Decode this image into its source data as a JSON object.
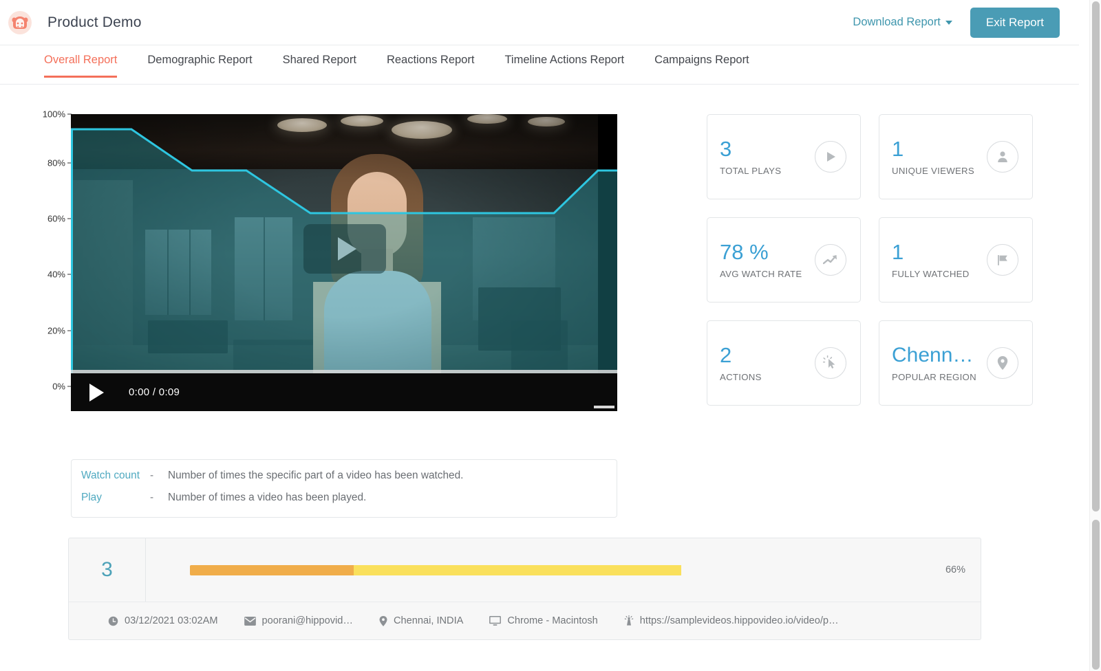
{
  "header": {
    "logo_icon": "hippo-logo-icon",
    "title": "Product Demo",
    "download_label": "Download Report",
    "exit_label": "Exit Report",
    "accent_color": "#f4705a",
    "button_color": "#4a9cb5",
    "link_color": "#3f96ad"
  },
  "tabs": [
    {
      "label": "Overall Report",
      "active": true
    },
    {
      "label": "Demographic Report",
      "active": false
    },
    {
      "label": "Shared Report",
      "active": false
    },
    {
      "label": "Reactions Report",
      "active": false
    },
    {
      "label": "Timeline Actions Report",
      "active": false
    },
    {
      "label": "Campaigns Report",
      "active": false
    }
  ],
  "player": {
    "current_time": "0:00",
    "duration": "0:09",
    "time_display": "0:00 / 0:09",
    "play_icon": "play-icon",
    "overlay_play_icon": "play-overlay-icon"
  },
  "chart_data": {
    "type": "area",
    "title": "Watch count over video timeline",
    "xlabel": "",
    "ylabel": "",
    "ylim": [
      0,
      100
    ],
    "yticks": [
      "0%",
      "20%",
      "40%",
      "60%",
      "80%",
      "100%"
    ],
    "ytick_values": [
      0,
      20,
      40,
      60,
      80,
      100
    ],
    "grid": false,
    "line_color": "#2ec6e0",
    "fill_color": "rgba(45,160,170,0.45)",
    "series": [
      {
        "name": "Watch count",
        "x": [
          0,
          11,
          22,
          33,
          44,
          88,
          97,
          100
        ],
        "values": [
          100,
          100,
          86,
          86,
          72,
          72,
          86,
          86
        ]
      }
    ]
  },
  "stat_cards": [
    {
      "value": "3",
      "label": "TOTAL PLAYS",
      "icon": "play-circle-icon"
    },
    {
      "value": "1",
      "label": "UNIQUE VIEWERS",
      "icon": "user-icon"
    },
    {
      "value": "78 %",
      "label": "AVG WATCH RATE",
      "icon": "trending-up-icon"
    },
    {
      "value": "1",
      "label": "FULLY WATCHED",
      "icon": "flag-icon"
    },
    {
      "value": "2",
      "label": "ACTIONS",
      "icon": "click-cursor-icon"
    },
    {
      "value": "Chenn…",
      "label": "POPULAR REGION",
      "icon": "map-pin-icon"
    }
  ],
  "legend": [
    {
      "term": "Watch count",
      "dash": "-",
      "description": "Number of times the specific part of a video has been watched."
    },
    {
      "term": "Play",
      "dash": "-",
      "description": "Number of times a video has been played."
    }
  ],
  "viewer": {
    "play_count": "3",
    "progress_percent_label": "66%",
    "progress_percent": 66,
    "segment_a_percent": 22,
    "segment_b_percent": 44,
    "segment_a_color": "#f0ad4a",
    "segment_b_color": "#fae05c",
    "meta": [
      {
        "icon": "clock-icon",
        "text": "03/12/2021 03:02AM"
      },
      {
        "icon": "envelope-icon",
        "text": "poorani@hippovid…"
      },
      {
        "icon": "map-pin-icon",
        "text": "Chennai, INDIA"
      },
      {
        "icon": "monitor-icon",
        "text": "Chrome - Macintosh"
      },
      {
        "icon": "source-icon",
        "text": "https://samplevideos.hippovideo.io/video/p…"
      }
    ]
  }
}
